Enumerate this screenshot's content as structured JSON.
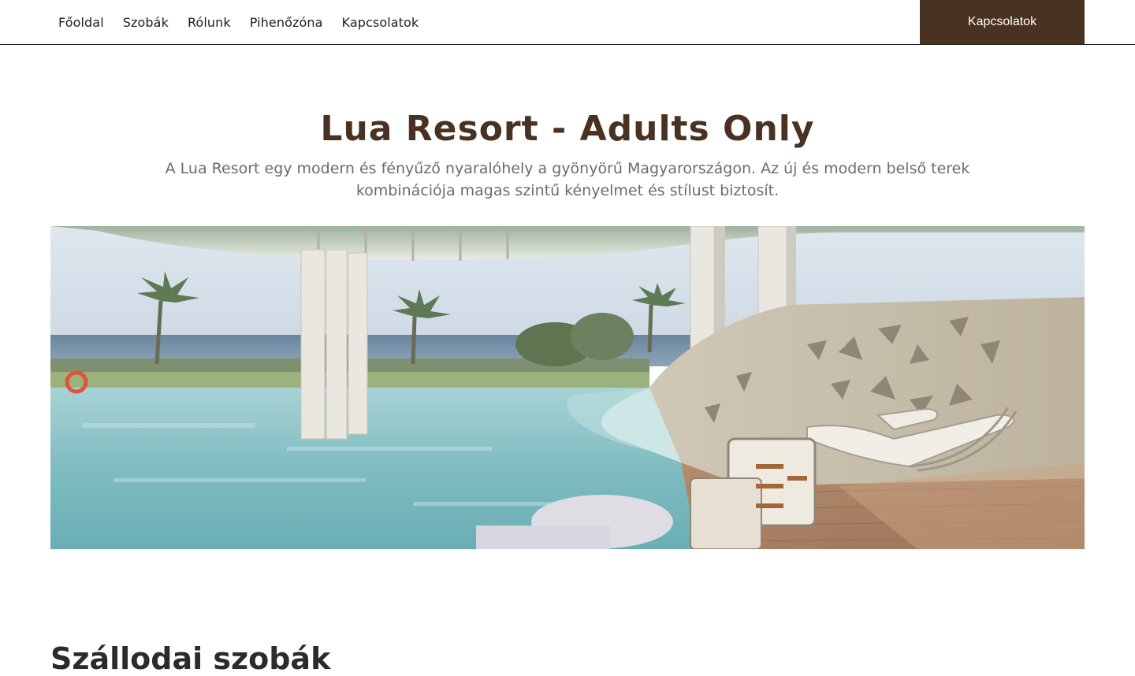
{
  "nav": {
    "links": [
      "Főoldal",
      "Szobák",
      "Rólunk",
      "Pihenőzóna",
      "Kapcsolatok"
    ],
    "cta_label": "Kapcsolatok"
  },
  "hero": {
    "title": "Lua Resort - Adults Only",
    "subtitle": "A Lua Resort egy modern és fényűző nyaralóhely a gyönyörű Magyarországon. Az új és modern belső terek kombinációja magas szintű kényelmet és stílust biztosít."
  },
  "rooms_section": {
    "title": "Szállodai szobák"
  },
  "colors": {
    "brand_brown": "#4a3222",
    "nav_text": "#1f1f1f",
    "subtitle_gray": "#6b6b6b"
  }
}
